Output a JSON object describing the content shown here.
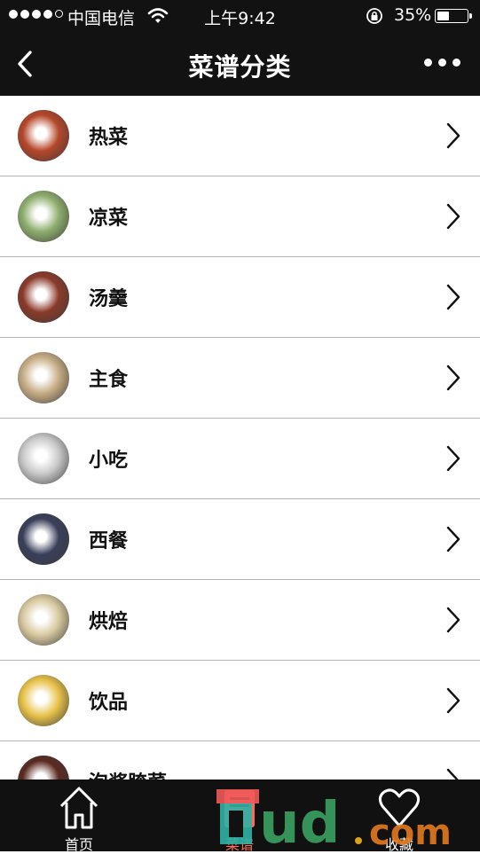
{
  "status_bar": {
    "carrier": "中国电信",
    "time": "上午9:42",
    "battery_percent": "35%",
    "battery_level": 0.35
  },
  "nav": {
    "title": "菜谱分类"
  },
  "categories": [
    {
      "label": "热菜",
      "thumb_color": "#b5472a"
    },
    {
      "label": "凉菜",
      "thumb_color": "#8fae6e"
    },
    {
      "label": "汤羹",
      "thumb_color": "#8a3a2a"
    },
    {
      "label": "主食",
      "thumb_color": "#c7ad86"
    },
    {
      "label": "小吃",
      "thumb_color": "#c9c9c9"
    },
    {
      "label": "西餐",
      "thumb_color": "#3a3f5a"
    },
    {
      "label": "烘焙",
      "thumb_color": "#d8c9a0"
    },
    {
      "label": "饮品",
      "thumb_color": "#e8c24a"
    },
    {
      "label": "泡酱腌菜",
      "thumb_color": "#5a2a20"
    }
  ],
  "tabbar": {
    "home": "首页",
    "recipes": "菜谱",
    "favorites": "收藏",
    "active": "recipes",
    "accent_color": "#ff6b5b"
  },
  "watermark": {
    "text": "Iud.com"
  }
}
